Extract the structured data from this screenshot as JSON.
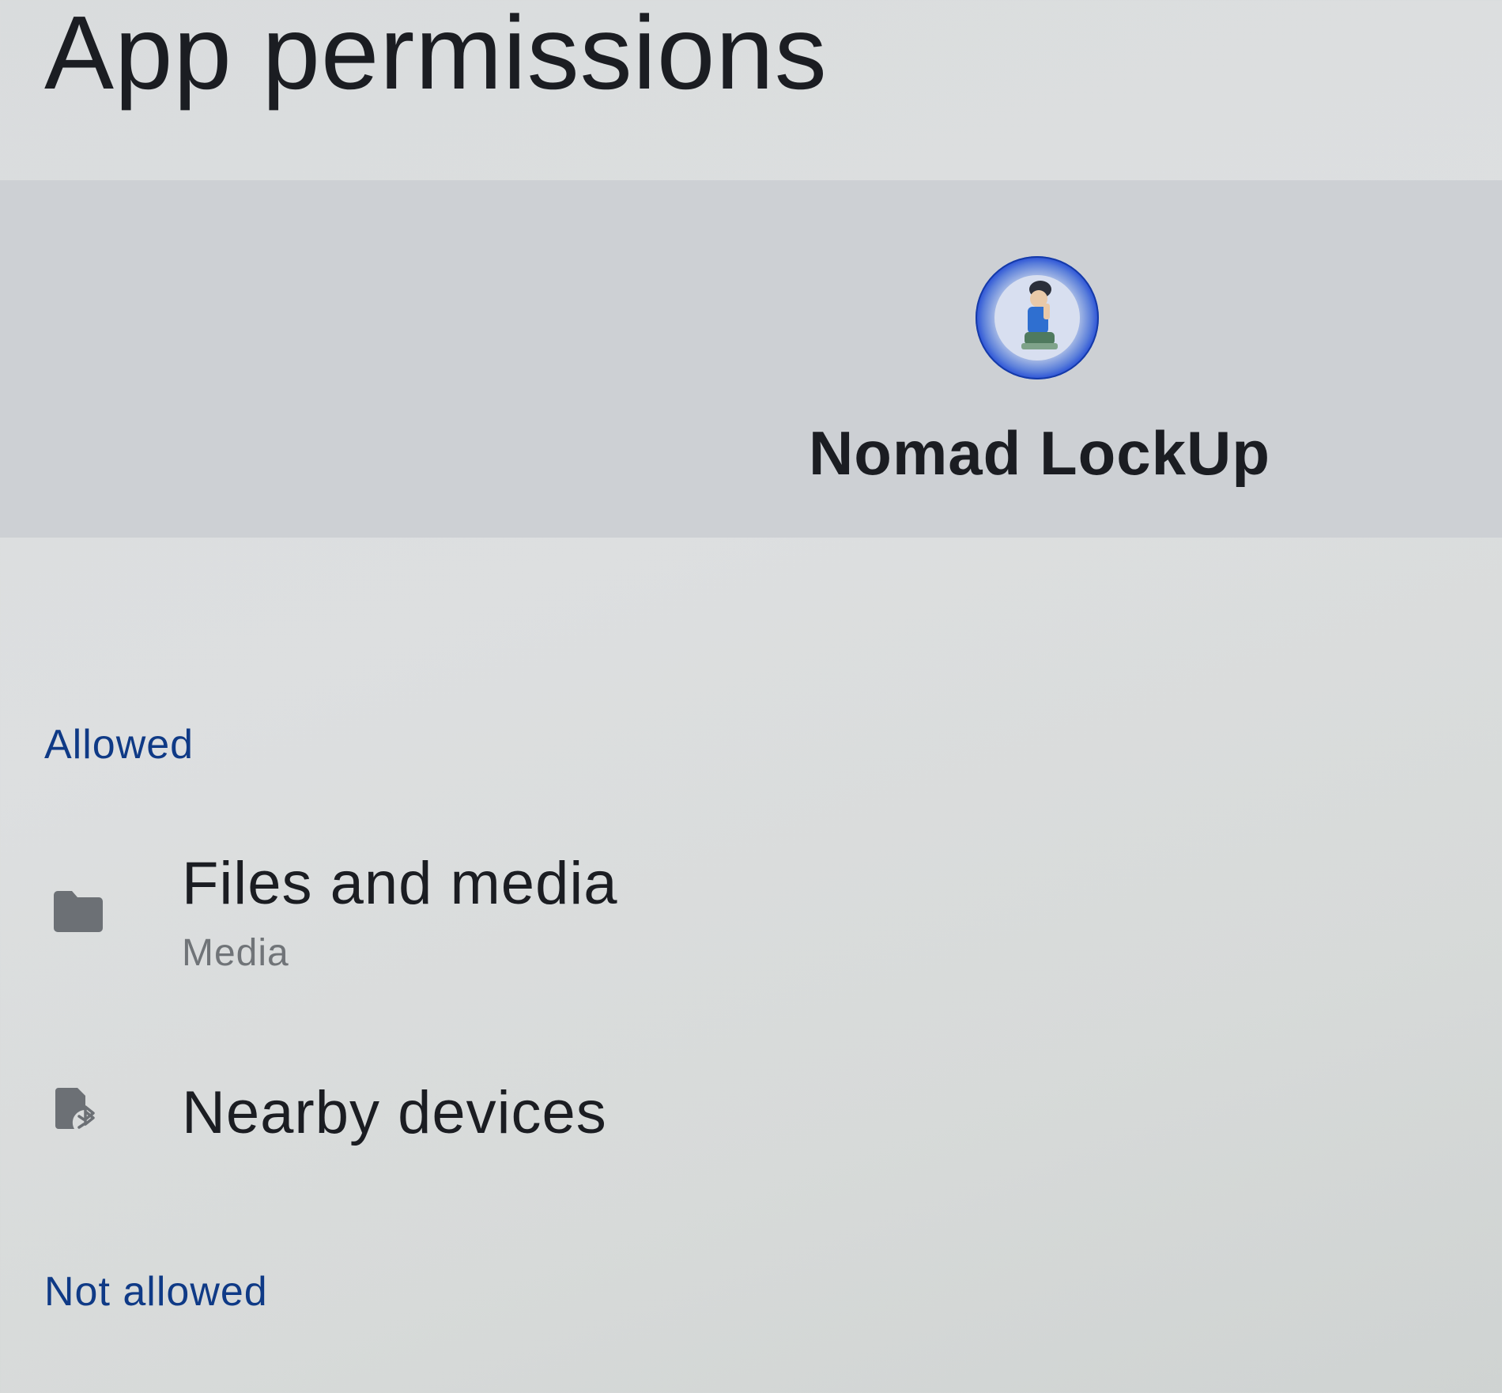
{
  "header": {
    "title": "App permissions"
  },
  "app": {
    "name": "Nomad LockUp",
    "icon": "app-icon",
    "icon_ring_color": "#1f47d6"
  },
  "sections": {
    "allowed": {
      "label": "Allowed",
      "items": [
        {
          "title": "Files and media",
          "subtitle": "Media",
          "icon": "folder-icon"
        },
        {
          "title": "Nearby devices",
          "subtitle": "",
          "icon": "nearby-devices-icon"
        }
      ]
    },
    "not_allowed": {
      "label": "Not allowed"
    }
  },
  "colors": {
    "section_label": "#0f3a86",
    "icon_gray": "#6c7075",
    "header_band": "#cdd0d4"
  }
}
